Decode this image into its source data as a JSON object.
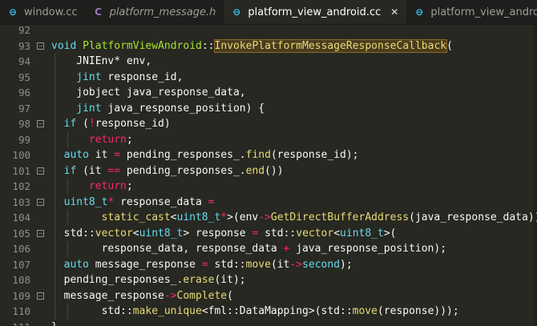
{
  "tabs": [
    {
      "label": "window.cc",
      "icon": "cpp-file-icon",
      "glyph": "⊖",
      "color": "#39c0ed",
      "active": false,
      "italic": false
    },
    {
      "label": "platform_message.h",
      "icon": "c-header-file-icon",
      "glyph": "C",
      "color": "#a074c4",
      "active": false,
      "italic": true
    },
    {
      "label": "platform_view_android.cc",
      "icon": "cpp-file-icon",
      "glyph": "⊖",
      "color": "#39c0ed",
      "active": true,
      "italic": false
    },
    {
      "label": "platform_view_android.j",
      "icon": "cpp-file-icon",
      "glyph": "⊖",
      "color": "#39c0ed",
      "active": false,
      "italic": false
    }
  ],
  "close_glyph": "✕",
  "lines": [
    {
      "n": "92",
      "fold": "",
      "indent": 0,
      "tokens": []
    },
    {
      "n": "93",
      "fold": "−",
      "indent": 0,
      "tokens": [
        [
          "kw",
          "void"
        ],
        [
          "plain",
          " "
        ],
        [
          "cls",
          "PlatformViewAndroid"
        ],
        [
          "op",
          "::"
        ],
        [
          "fnh",
          "InvokePlatformMessageResponseCallback"
        ],
        [
          "plain",
          "("
        ]
      ]
    },
    {
      "n": "94",
      "fold": "",
      "indent": 1,
      "tokens": [
        [
          "plain",
          "  JNIEnv* env,"
        ]
      ]
    },
    {
      "n": "95",
      "fold": "",
      "indent": 1,
      "tokens": [
        [
          "plain",
          "  "
        ],
        [
          "kw",
          "jint"
        ],
        [
          "plain",
          " response_id,"
        ]
      ]
    },
    {
      "n": "96",
      "fold": "",
      "indent": 1,
      "tokens": [
        [
          "plain",
          "  jobject java_response_data,"
        ]
      ]
    },
    {
      "n": "97",
      "fold": "",
      "indent": 1,
      "tokens": [
        [
          "plain",
          "  "
        ],
        [
          "kw",
          "jint"
        ],
        [
          "plain",
          " java_response_position) {"
        ]
      ]
    },
    {
      "n": "98",
      "fold": "−",
      "indent": 1,
      "tokens": [
        [
          "kw",
          "if"
        ],
        [
          "plain",
          " ("
        ],
        [
          "ret",
          "!"
        ],
        [
          "plain",
          "response_id)"
        ]
      ]
    },
    {
      "n": "99",
      "fold": "",
      "indent": 2,
      "tokens": [
        [
          "plain",
          "  "
        ],
        [
          "ret",
          "return"
        ],
        [
          "plain",
          ";"
        ]
      ]
    },
    {
      "n": "100",
      "fold": "",
      "indent": 1,
      "tokens": [
        [
          "kw",
          "auto"
        ],
        [
          "plain",
          " it "
        ],
        [
          "ret",
          "="
        ],
        [
          "plain",
          " pending_responses_."
        ],
        [
          "fn",
          "find"
        ],
        [
          "plain",
          "(response_id);"
        ]
      ]
    },
    {
      "n": "101",
      "fold": "−",
      "indent": 1,
      "tokens": [
        [
          "kw",
          "if"
        ],
        [
          "plain",
          " (it "
        ],
        [
          "ret",
          "=="
        ],
        [
          "plain",
          " pending_responses_."
        ],
        [
          "fn",
          "end"
        ],
        [
          "plain",
          "())"
        ]
      ]
    },
    {
      "n": "102",
      "fold": "",
      "indent": 2,
      "tokens": [
        [
          "plain",
          "  "
        ],
        [
          "ret",
          "return"
        ],
        [
          "plain",
          ";"
        ]
      ]
    },
    {
      "n": "103",
      "fold": "−",
      "indent": 1,
      "tokens": [
        [
          "kw",
          "uint8_t"
        ],
        [
          "ret",
          "*"
        ],
        [
          "plain",
          " response_data "
        ],
        [
          "ret",
          "="
        ]
      ]
    },
    {
      "n": "104",
      "fold": "",
      "indent": 2,
      "tokens": [
        [
          "plain",
          "    "
        ],
        [
          "fn",
          "static_cast"
        ],
        [
          "plain",
          "<"
        ],
        [
          "kw",
          "uint8_t"
        ],
        [
          "ret",
          "*"
        ],
        [
          "plain",
          ">(env"
        ],
        [
          "ret",
          "->"
        ],
        [
          "fn",
          "GetDirectBufferAddress"
        ],
        [
          "plain",
          "(java_response_data));"
        ]
      ]
    },
    {
      "n": "105",
      "fold": "−",
      "indent": 1,
      "tokens": [
        [
          "plain",
          "std::"
        ],
        [
          "fn",
          "vector"
        ],
        [
          "plain",
          "<"
        ],
        [
          "kw",
          "uint8_t"
        ],
        [
          "plain",
          "> response "
        ],
        [
          "ret",
          "="
        ],
        [
          "plain",
          " std::"
        ],
        [
          "fn",
          "vector"
        ],
        [
          "plain",
          "<"
        ],
        [
          "kw",
          "uint8_t"
        ],
        [
          "plain",
          ">("
        ]
      ]
    },
    {
      "n": "106",
      "fold": "",
      "indent": 2,
      "tokens": [
        [
          "plain",
          "    response_data, response_data "
        ],
        [
          "ret",
          "+"
        ],
        [
          "plain",
          " java_response_position);"
        ]
      ]
    },
    {
      "n": "107",
      "fold": "",
      "indent": 1,
      "tokens": [
        [
          "kw",
          "auto"
        ],
        [
          "plain",
          " message_response "
        ],
        [
          "ret",
          "="
        ],
        [
          "plain",
          " std::"
        ],
        [
          "fn",
          "move"
        ],
        [
          "plain",
          "(it"
        ],
        [
          "ret",
          "->"
        ],
        [
          "mem",
          "second"
        ],
        [
          "plain",
          ");"
        ]
      ]
    },
    {
      "n": "108",
      "fold": "",
      "indent": 1,
      "tokens": [
        [
          "plain",
          "pending_responses_."
        ],
        [
          "fn",
          "erase"
        ],
        [
          "plain",
          "(it);"
        ]
      ]
    },
    {
      "n": "109",
      "fold": "−",
      "indent": 1,
      "tokens": [
        [
          "plain",
          "message_response"
        ],
        [
          "ret",
          "->"
        ],
        [
          "fn",
          "Complete"
        ],
        [
          "plain",
          "("
        ]
      ]
    },
    {
      "n": "110",
      "fold": "",
      "indent": 2,
      "tokens": [
        [
          "plain",
          "    std::"
        ],
        [
          "fn",
          "make_unique"
        ],
        [
          "plain",
          "<fml::DataMapping>(std::"
        ],
        [
          "fn",
          "move"
        ],
        [
          "plain",
          "(response)));"
        ]
      ]
    },
    {
      "n": "111",
      "fold": "",
      "indent": 0,
      "tokens": [
        [
          "plain",
          "}"
        ]
      ]
    }
  ]
}
